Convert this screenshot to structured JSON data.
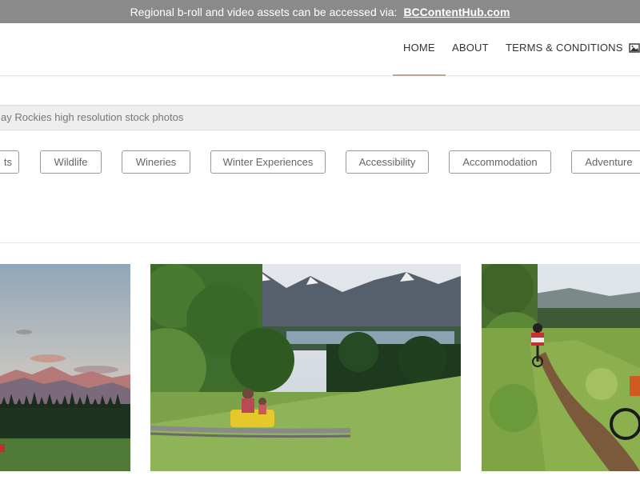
{
  "banner": {
    "text": "Regional b-roll and video assets can be accessed via:",
    "link": "BCContentHub.com"
  },
  "nav": {
    "home": "HOME",
    "about": "ABOUT",
    "terms": "TERMS & CONDITIONS",
    "gallery_icon": "image-icon"
  },
  "search": {
    "placeholder": "ay Rockies high resolution stock photos"
  },
  "categories": [
    "ts",
    "Wildlife",
    "Wineries",
    "Winter Experiences",
    "Accessibility",
    "Accommodation",
    "Adventure"
  ],
  "colors": {
    "banner_bg": "#8a8a8a",
    "active_underline": "#b8a898",
    "pill_border": "#9a9a9a"
  }
}
